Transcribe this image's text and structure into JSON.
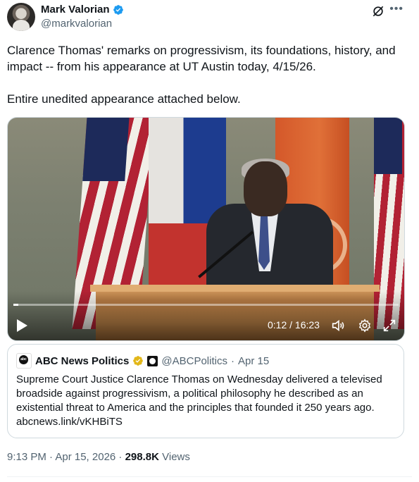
{
  "author": {
    "name": "Mark Valorian",
    "handle": "@markvalorian"
  },
  "tweet": {
    "line1": "Clarence Thomas' remarks on progressivism, its foundations, history, and impact -- from his appearance at UT Austin today, 4/15/26.",
    "line2": "Entire unedited appearance attached below."
  },
  "video": {
    "time": "0:12 / 16:23",
    "progress_fraction": 0.012
  },
  "quote": {
    "name": "ABC News Politics",
    "handle": "@ABCPolitics",
    "separator": "·",
    "date": "Apr 15",
    "text": "Supreme Court Justice Clarence Thomas on Wednesday delivered a televised broadside against progressivism, a political philosophy he described as an existential threat to America and the principles that founded it 250 years ago.",
    "link": "abcnews.link/vKHBiTS"
  },
  "meta": {
    "time_date": "9:13 PM · Apr 15, 2026 · ",
    "views_count": "298.8K",
    "views_label": " Views"
  },
  "colors": {
    "verified_blue": "#1d9bf0",
    "gold": "#e2b719",
    "secondary_text": "#536471"
  }
}
